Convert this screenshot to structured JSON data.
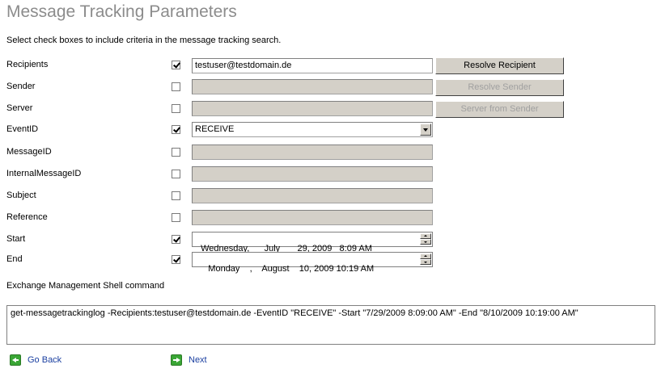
{
  "title": "Message Tracking Parameters",
  "instruction": "Select check boxes to include criteria in the message tracking search.",
  "fields": {
    "recipients": {
      "label": "Recipients",
      "checked": true,
      "value": "testuser@testdomain.de",
      "button": "Resolve Recipient"
    },
    "sender": {
      "label": "Sender",
      "checked": false,
      "value": "",
      "button": "Resolve Sender"
    },
    "server": {
      "label": "Server",
      "checked": false,
      "value": "",
      "button": "Server from Sender"
    },
    "eventid": {
      "label": "EventID",
      "checked": true,
      "value": "RECEIVE"
    },
    "messageid": {
      "label": "MessageID",
      "checked": false,
      "value": ""
    },
    "internalmessageid": {
      "label": "InternalMessageID",
      "checked": false,
      "value": ""
    },
    "subject": {
      "label": "Subject",
      "checked": false,
      "value": ""
    },
    "reference": {
      "label": "Reference",
      "checked": false,
      "value": ""
    },
    "start": {
      "label": "Start",
      "checked": true,
      "value": "Wednesday,      July       29, 2009   8:09 AM"
    },
    "end": {
      "label": "End",
      "checked": true,
      "value": "   Monday    ,    August    10, 2009 10:19 AM"
    }
  },
  "command": {
    "label": "Exchange Management Shell command",
    "text": "get-messagetrackinglog -Recipients:testuser@testdomain.de -EventID \"RECEIVE\" -Start \"7/29/2009 8:09:00 AM\" -End \"8/10/2009 10:19:00 AM\""
  },
  "nav": {
    "back": "Go Back",
    "next": "Next"
  },
  "icons": {
    "back": "arrow-left-icon",
    "next": "arrow-right-icon",
    "spin": "spinner-icon",
    "dropdown": "chevron-down-icon"
  }
}
